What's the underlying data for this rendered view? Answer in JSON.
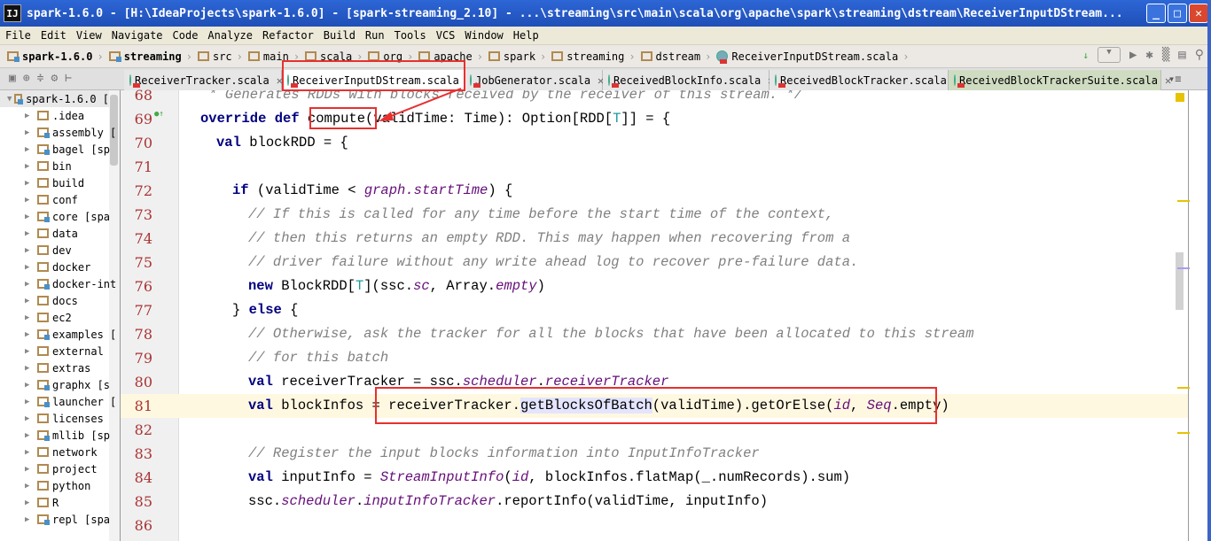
{
  "window": {
    "title": "spark-1.6.0 - [H:\\IdeaProjects\\spark-1.6.0] - [spark-streaming_2.10] - ...\\streaming\\src\\main\\scala\\org\\apache\\spark\\streaming\\dstream\\ReceiverInputDStream...",
    "logo": "IJ"
  },
  "menu": [
    "File",
    "Edit",
    "View",
    "Navigate",
    "Code",
    "Analyze",
    "Refactor",
    "Build",
    "Run",
    "Tools",
    "VCS",
    "Window",
    "Help"
  ],
  "breadcrumb": [
    {
      "label": "spark-1.6.0",
      "bold": true,
      "icon": "module-folder"
    },
    {
      "label": "streaming",
      "bold": true,
      "icon": "module-folder"
    },
    {
      "label": "src",
      "icon": "folder"
    },
    {
      "label": "main",
      "icon": "folder"
    },
    {
      "label": "scala",
      "icon": "folder"
    },
    {
      "label": "org",
      "icon": "package"
    },
    {
      "label": "apache",
      "icon": "package"
    },
    {
      "label": "spark",
      "icon": "package"
    },
    {
      "label": "streaming",
      "icon": "package"
    },
    {
      "label": "dstream",
      "icon": "package"
    },
    {
      "label": "ReceiverInputDStream.scala",
      "icon": "scala-file"
    }
  ],
  "tabs": [
    {
      "label": "ReceiverTracker.scala"
    },
    {
      "label": "ReceiverInputDStream.scala",
      "active": true
    },
    {
      "label": "JobGenerator.scala"
    },
    {
      "label": "ReceivedBlockInfo.scala"
    },
    {
      "label": "ReceivedBlockTracker.scala"
    },
    {
      "label": "ReceivedBlockTrackerSuite.scala",
      "highlight": true
    }
  ],
  "project_tree": [
    {
      "label": "spark-1.6.0 [",
      "root": true,
      "module": true
    },
    {
      "label": ".idea"
    },
    {
      "label": "assembly [",
      "module": true
    },
    {
      "label": "bagel [sp",
      "module": true
    },
    {
      "label": "bin"
    },
    {
      "label": "build"
    },
    {
      "label": "conf"
    },
    {
      "label": "core [spa",
      "module": true
    },
    {
      "label": "data"
    },
    {
      "label": "dev"
    },
    {
      "label": "docker"
    },
    {
      "label": "docker-int",
      "module": true
    },
    {
      "label": "docs"
    },
    {
      "label": "ec2"
    },
    {
      "label": "examples [",
      "module": true
    },
    {
      "label": "external"
    },
    {
      "label": "extras"
    },
    {
      "label": "graphx [s",
      "module": true
    },
    {
      "label": "launcher [",
      "module": true
    },
    {
      "label": "licenses"
    },
    {
      "label": "mllib [sp",
      "module": true
    },
    {
      "label": "network"
    },
    {
      "label": "project"
    },
    {
      "label": "python"
    },
    {
      "label": "R"
    },
    {
      "label": "repl [spa",
      "module": true
    }
  ],
  "code": [
    {
      "n": "68",
      "indent": 1,
      "t": [
        [
          " * Generates RDDs with blocks received by the receiver of this stream. */",
          "cm"
        ]
      ]
    },
    {
      "n": "69",
      "indent": 1,
      "t": [
        [
          "override def ",
          "kw"
        ],
        [
          "compute",
          ""
        ],
        [
          "(validTime: Time): Option[RDD[",
          ""
        ],
        [
          "T",
          "tp"
        ],
        [
          "]] = {",
          ""
        ]
      ]
    },
    {
      "n": "70",
      "indent": 2,
      "t": [
        [
          "val ",
          "kw"
        ],
        [
          "blockRDD = {",
          ""
        ]
      ]
    },
    {
      "n": "71",
      "indent": 0,
      "t": []
    },
    {
      "n": "72",
      "indent": 3,
      "t": [
        [
          "if ",
          "kw"
        ],
        [
          "(validTime < ",
          ""
        ],
        [
          "graph.startTime",
          "it"
        ],
        [
          ") {",
          ""
        ]
      ]
    },
    {
      "n": "73",
      "indent": 4,
      "t": [
        [
          "// If this is called for any time before the start time of the context,",
          "cm"
        ]
      ]
    },
    {
      "n": "74",
      "indent": 4,
      "t": [
        [
          "// then this returns an empty RDD. This may happen when recovering from a",
          "cm"
        ]
      ]
    },
    {
      "n": "75",
      "indent": 4,
      "t": [
        [
          "// driver failure without any write ahead log to recover pre-failure data.",
          "cm"
        ]
      ]
    },
    {
      "n": "76",
      "indent": 4,
      "t": [
        [
          "new ",
          "kw"
        ],
        [
          "BlockRDD[",
          ""
        ],
        [
          "T",
          "tp"
        ],
        [
          "](ssc.",
          ""
        ],
        [
          "sc",
          "it"
        ],
        [
          ", Array.",
          ""
        ],
        [
          "empty",
          "it"
        ],
        [
          ")",
          ""
        ]
      ]
    },
    {
      "n": "77",
      "indent": 3,
      "t": [
        [
          "} ",
          ""
        ],
        [
          "else ",
          "kw"
        ],
        [
          "{",
          ""
        ]
      ]
    },
    {
      "n": "78",
      "indent": 4,
      "t": [
        [
          "// Otherwise, ask the tracker for all the blocks that have been allocated to this stream",
          "cm"
        ]
      ]
    },
    {
      "n": "79",
      "indent": 4,
      "t": [
        [
          "// for this batch",
          "cm"
        ]
      ]
    },
    {
      "n": "80",
      "indent": 4,
      "t": [
        [
          "val ",
          "kw"
        ],
        [
          "receiverTracker = ssc.",
          ""
        ],
        [
          "scheduler",
          "it"
        ],
        [
          ".",
          ""
        ],
        [
          "receiverTracker",
          "it"
        ]
      ]
    },
    {
      "n": "81",
      "indent": 4,
      "current": true,
      "t": [
        [
          "val ",
          "kw"
        ],
        [
          "blockInfos = receiverTracker.",
          ""
        ],
        [
          "getBlocksOfBatch",
          "hl"
        ],
        [
          "(validTime).getOrElse(",
          ""
        ],
        [
          "id",
          "it"
        ],
        [
          ", ",
          ""
        ],
        [
          "Seq",
          "it"
        ],
        [
          ".empty)",
          ""
        ]
      ]
    },
    {
      "n": "82",
      "indent": 0,
      "t": []
    },
    {
      "n": "83",
      "indent": 4,
      "t": [
        [
          "// Register the input blocks information into InputInfoTracker",
          "cm"
        ]
      ]
    },
    {
      "n": "84",
      "indent": 4,
      "t": [
        [
          "val ",
          "kw"
        ],
        [
          "inputInfo = ",
          ""
        ],
        [
          "StreamInputInfo",
          "it"
        ],
        [
          "(",
          ""
        ],
        [
          "id",
          "it"
        ],
        [
          ", blockInfos.flatMap(_.numRecords).sum)",
          ""
        ]
      ]
    },
    {
      "n": "85",
      "indent": 4,
      "t": [
        [
          "ssc.",
          ""
        ],
        [
          "scheduler",
          "it"
        ],
        [
          ".",
          ""
        ],
        [
          "inputInfoTracker",
          "it"
        ],
        [
          ".reportInfo(validTime, inputInfo)",
          ""
        ]
      ]
    },
    {
      "n": "86",
      "indent": 0,
      "t": []
    }
  ],
  "colors": {
    "annotation": "#e8302f",
    "keyword": "#000080",
    "comment": "#808080",
    "line_number": "#aa3333",
    "current_line": "#fff8e1"
  }
}
